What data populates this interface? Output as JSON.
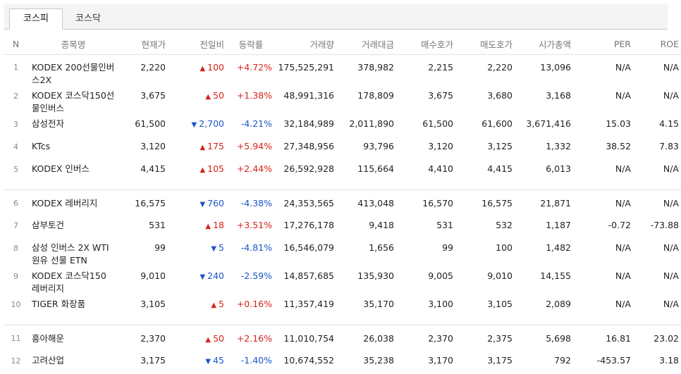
{
  "tabs": [
    "코스피",
    "코스닥"
  ],
  "columns": [
    "N",
    "종목명",
    "현재가",
    "전일비",
    "등락률",
    "거래량",
    "거래대금",
    "매수호가",
    "매도호가",
    "시가총액",
    "PER",
    "ROE"
  ],
  "rows": [
    {
      "n": "1",
      "name": "KODEX 200선물인버스2X",
      "price": "2,220",
      "dir": "up",
      "arrow": "▲",
      "change": "100",
      "rate": "+4.72%",
      "volume": "175,525,291",
      "amount": "378,982",
      "bid": "2,215",
      "ask": "2,220",
      "cap": "13,096",
      "per": "N/A",
      "roe": "N/A"
    },
    {
      "n": "2",
      "name": "KODEX 코스닥150선물인버스",
      "price": "3,675",
      "dir": "up",
      "arrow": "▲",
      "change": "50",
      "rate": "+1.38%",
      "volume": "48,991,316",
      "amount": "178,809",
      "bid": "3,675",
      "ask": "3,680",
      "cap": "3,168",
      "per": "N/A",
      "roe": "N/A"
    },
    {
      "n": "3",
      "name": "삼성전자",
      "price": "61,500",
      "dir": "down",
      "arrow": "▼",
      "change": "2,700",
      "rate": "-4.21%",
      "volume": "32,184,989",
      "amount": "2,011,890",
      "bid": "61,500",
      "ask": "61,600",
      "cap": "3,671,416",
      "per": "15.03",
      "roe": "4.15"
    },
    {
      "n": "4",
      "name": "KTcs",
      "price": "3,120",
      "dir": "up",
      "arrow": "▲",
      "change": "175",
      "rate": "+5.94%",
      "volume": "27,348,956",
      "amount": "93,796",
      "bid": "3,120",
      "ask": "3,125",
      "cap": "1,332",
      "per": "38.52",
      "roe": "7.83"
    },
    {
      "n": "5",
      "name": "KODEX 인버스",
      "price": "4,415",
      "dir": "up",
      "arrow": "▲",
      "change": "105",
      "rate": "+2.44%",
      "volume": "26,592,928",
      "amount": "115,664",
      "bid": "4,410",
      "ask": "4,415",
      "cap": "6,013",
      "per": "N/A",
      "roe": "N/A"
    },
    {
      "n": "6",
      "name": "KODEX 레버리지",
      "price": "16,575",
      "dir": "down",
      "arrow": "▼",
      "change": "760",
      "rate": "-4.38%",
      "volume": "24,353,565",
      "amount": "413,048",
      "bid": "16,570",
      "ask": "16,575",
      "cap": "21,871",
      "per": "N/A",
      "roe": "N/A"
    },
    {
      "n": "7",
      "name": "삼부토건",
      "price": "531",
      "dir": "up",
      "arrow": "▲",
      "change": "18",
      "rate": "+3.51%",
      "volume": "17,276,178",
      "amount": "9,418",
      "bid": "531",
      "ask": "532",
      "cap": "1,187",
      "per": "-0.72",
      "roe": "-73.88"
    },
    {
      "n": "8",
      "name": "삼성 인버스 2X WTI원유 선물 ETN",
      "price": "99",
      "dir": "down",
      "arrow": "▼",
      "change": "5",
      "rate": "-4.81%",
      "volume": "16,546,079",
      "amount": "1,656",
      "bid": "99",
      "ask": "100",
      "cap": "1,482",
      "per": "N/A",
      "roe": "N/A"
    },
    {
      "n": "9",
      "name": "KODEX 코스닥150 레버리지",
      "price": "9,010",
      "dir": "down",
      "arrow": "▼",
      "change": "240",
      "rate": "-2.59%",
      "volume": "14,857,685",
      "amount": "135,930",
      "bid": "9,005",
      "ask": "9,010",
      "cap": "14,155",
      "per": "N/A",
      "roe": "N/A"
    },
    {
      "n": "10",
      "name": "TIGER 화장품",
      "price": "3,105",
      "dir": "up",
      "arrow": "▲",
      "change": "5",
      "rate": "+0.16%",
      "volume": "11,357,419",
      "amount": "35,170",
      "bid": "3,100",
      "ask": "3,105",
      "cap": "2,089",
      "per": "N/A",
      "roe": "N/A"
    },
    {
      "n": "11",
      "name": "흥아해운",
      "price": "2,370",
      "dir": "up",
      "arrow": "▲",
      "change": "50",
      "rate": "+2.16%",
      "volume": "11,010,754",
      "amount": "26,038",
      "bid": "2,370",
      "ask": "2,375",
      "cap": "5,698",
      "per": "16.81",
      "roe": "23.02"
    },
    {
      "n": "12",
      "name": "고려산업",
      "price": "3,175",
      "dir": "down",
      "arrow": "▼",
      "change": "45",
      "rate": "-1.40%",
      "volume": "10,674,552",
      "amount": "35,238",
      "bid": "3,170",
      "ask": "3,175",
      "cap": "792",
      "per": "-453.57",
      "roe": "3.18"
    }
  ],
  "colors": {
    "up": "#d8221a",
    "down": "#1a55c9"
  }
}
